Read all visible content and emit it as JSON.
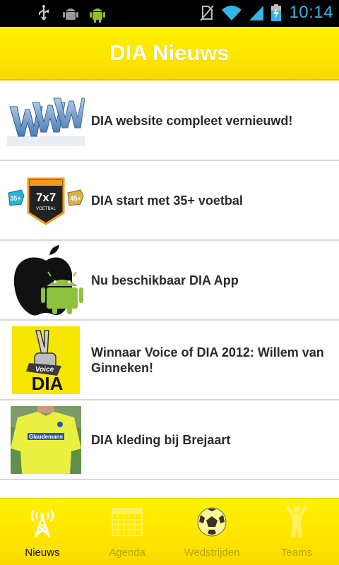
{
  "status_bar": {
    "time": "10:14",
    "icons": [
      "usb-icon",
      "android-debug-icon",
      "android-icon",
      "no-sim-icon",
      "wifi-icon",
      "signal-icon",
      "battery-charging-icon"
    ]
  },
  "header": {
    "title": "DIA Nieuws",
    "color": "#ffe600"
  },
  "news": [
    {
      "title": "DIA website compleet vernieuwd!",
      "thumb": "www-logo"
    },
    {
      "title": "DIA start met 35+ voetbal",
      "thumb": "7x7-voetbal-badge"
    },
    {
      "title": "Nu beschikbaar DIA App",
      "thumb": "apple-android-logo"
    },
    {
      "title": "Winnaar Voice of DIA 2012: Willem van Ginneken!",
      "thumb": "voice-of-dia-logo"
    },
    {
      "title": "DIA kleding bij Brejaart",
      "thumb": "yellow-shirt-photo"
    }
  ],
  "tabs": [
    {
      "label": "Nieuws",
      "icon": "antenna-icon",
      "active": true
    },
    {
      "label": "Agenda",
      "icon": "calendar-icon",
      "active": false
    },
    {
      "label": "Wedstrijden",
      "icon": "soccer-ball-icon",
      "active": false
    },
    {
      "label": "Teams",
      "icon": "player-icon",
      "active": false
    }
  ]
}
